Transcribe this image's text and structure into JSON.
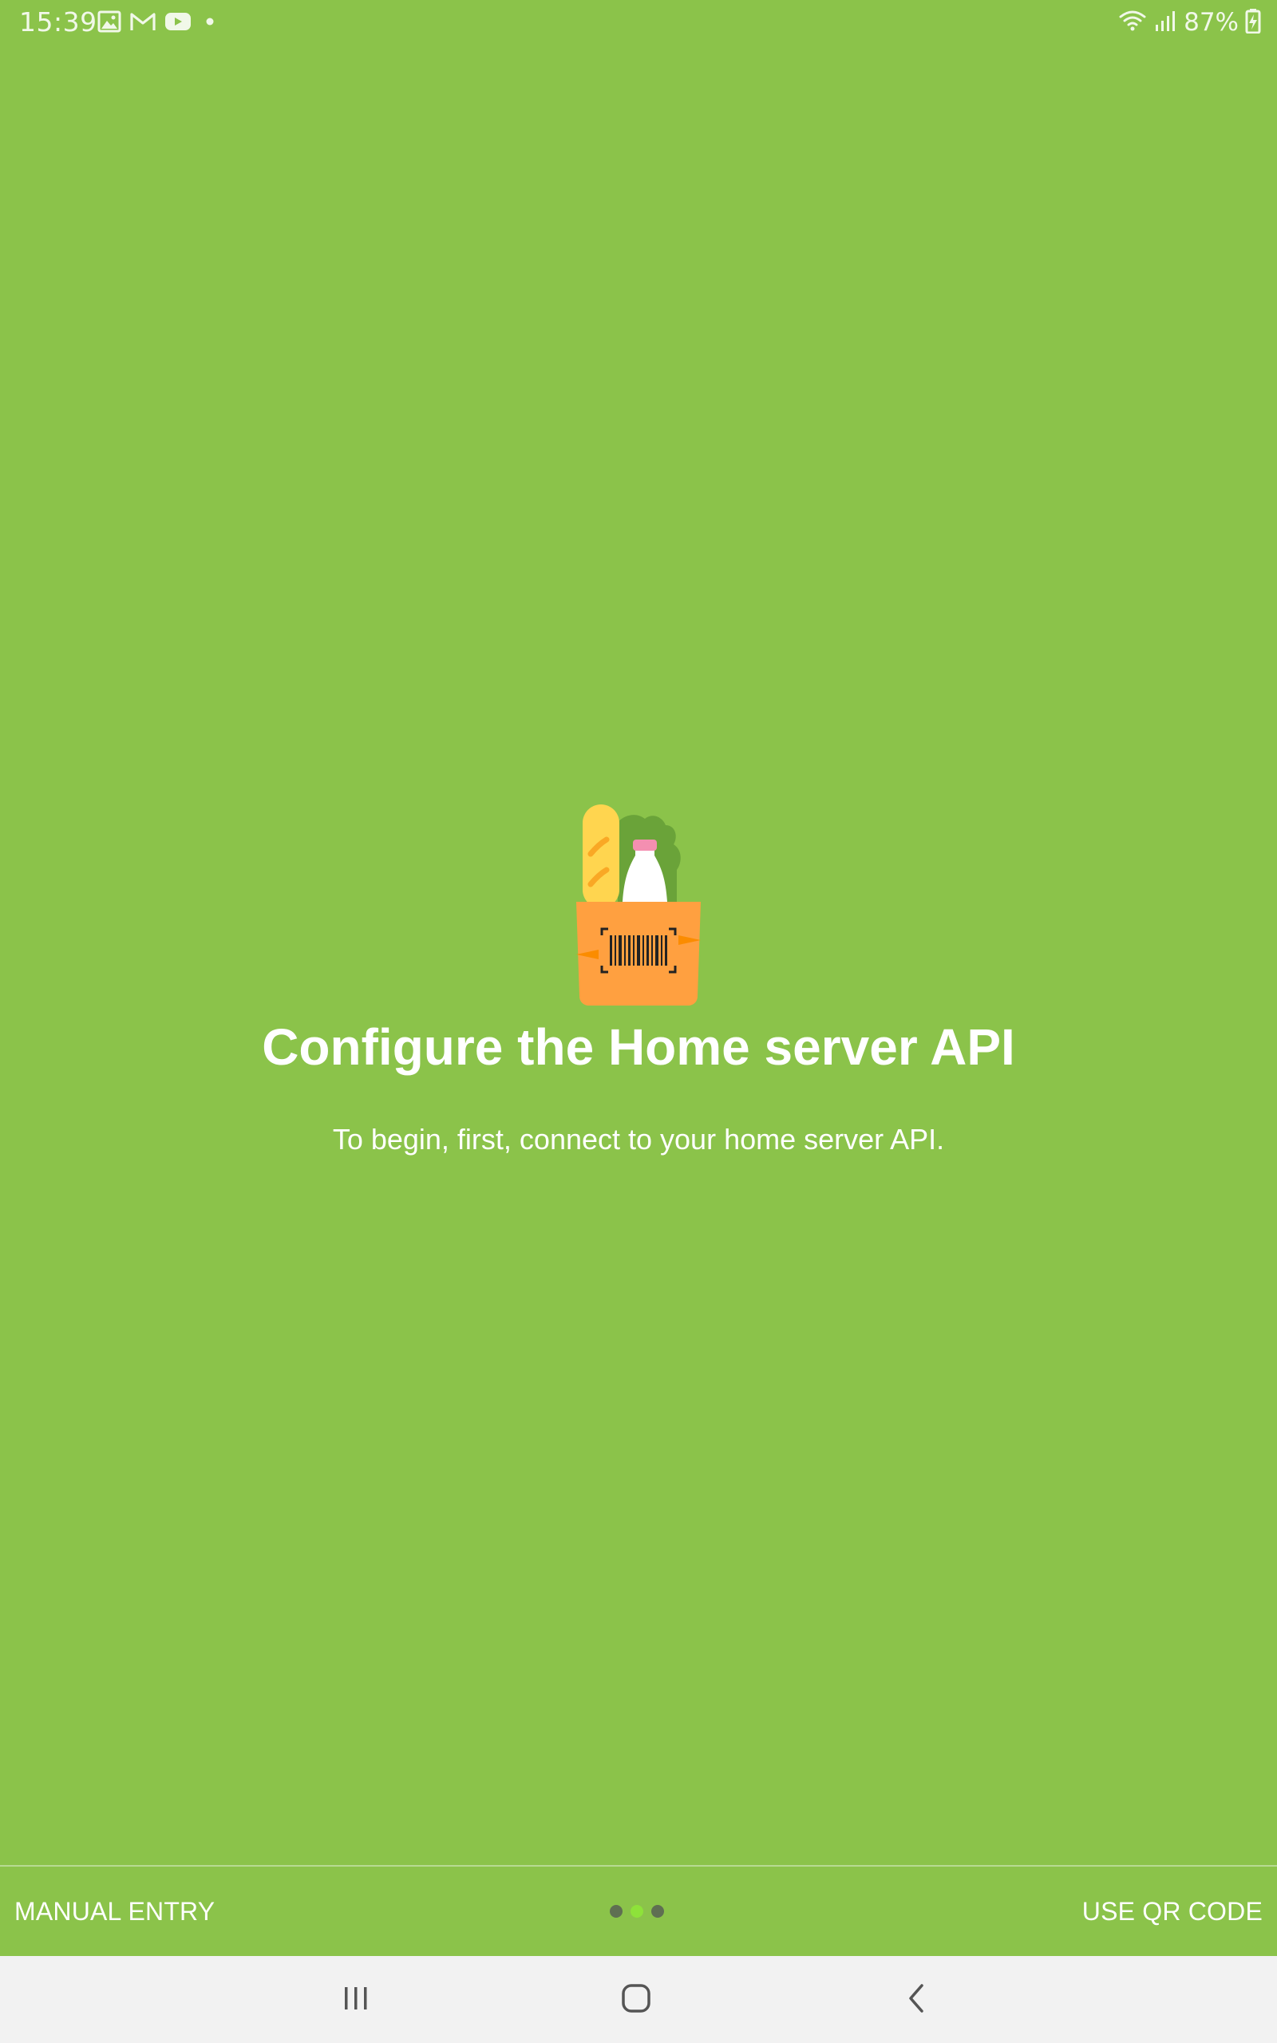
{
  "status_bar": {
    "time": "15:39",
    "battery": "87%",
    "left_icons": [
      "gallery-icon",
      "gmail-icon",
      "youtube-icon",
      "dot-icon"
    ],
    "right_icons": [
      "wifi-icon",
      "signal-icon",
      "battery-charging-icon"
    ]
  },
  "hero": {
    "title": "Configure the Home server API",
    "subtitle": "To begin, first, connect to your home server API."
  },
  "footer": {
    "left_button": "MANUAL ENTRY",
    "right_button": "USE QR CODE",
    "pager": {
      "total": 3,
      "active_index": 1
    }
  },
  "nav_bar": {
    "buttons": [
      "recents-icon",
      "home-icon",
      "back-icon"
    ]
  },
  "colors": {
    "background": "#8bc34a",
    "text": "#ffffff",
    "nav_background": "#f2f2f2",
    "dot_inactive": "#5f6f52",
    "dot_active": "#8ee23a",
    "bag": "#ffa040",
    "baguette": "#ffd54f",
    "lettuce": "#6aa339",
    "bottle_cap": "#f48fb1"
  }
}
